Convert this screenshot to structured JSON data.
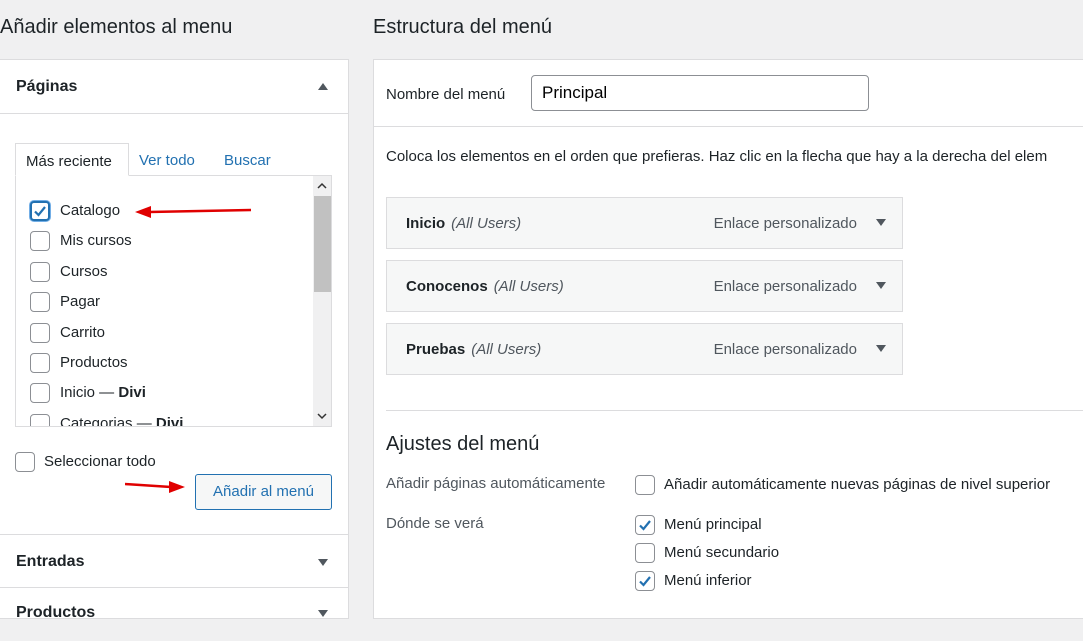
{
  "left": {
    "title": "Añadir elementos al menu",
    "pages_section": "Páginas",
    "tabs": [
      "Más reciente",
      "Ver todo",
      "Buscar"
    ],
    "pages": [
      {
        "label": "Catalogo",
        "checked": true
      },
      {
        "label": "Mis cursos",
        "checked": false
      },
      {
        "label": "Cursos",
        "checked": false
      },
      {
        "label": "Pagar",
        "checked": false
      },
      {
        "label": "Carrito",
        "checked": false
      },
      {
        "label": "Productos",
        "checked": false
      },
      {
        "label": "Inicio — ",
        "suffix": "Divi",
        "checked": false
      },
      {
        "label": "Categorias — ",
        "suffix": "Divi",
        "checked": false
      }
    ],
    "select_all": "Seleccionar todo",
    "add_button": "Añadir al menú",
    "entries_section": "Entradas",
    "products_section": "Productos"
  },
  "right": {
    "title": "Estructura del menú",
    "menu_name_label": "Nombre del menú",
    "menu_name_value": "Principal",
    "instructions": "Coloca los elementos en el orden que prefieras. Haz clic en la flecha que hay a la derecha del elem",
    "items": [
      {
        "name": "Inicio",
        "role": "(All Users)",
        "type": "Enlace personalizado"
      },
      {
        "name": "Conocenos",
        "role": "(All Users)",
        "type": "Enlace personalizado"
      },
      {
        "name": "Pruebas",
        "role": "(All Users)",
        "type": "Enlace personalizado"
      }
    ],
    "settings_title": "Ajustes del menú",
    "auto_add_label": "Añadir páginas automáticamente",
    "auto_add_option": "Añadir automáticamente nuevas páginas de nivel superior",
    "location_label": "Dónde se verá",
    "locations": [
      {
        "label": "Menú principal",
        "checked": true
      },
      {
        "label": "Menú secundario",
        "checked": false
      },
      {
        "label": "Menú inferior",
        "checked": true
      }
    ]
  },
  "colors": {
    "link": "#2271b1",
    "annotation_arrow": "#e00000"
  }
}
